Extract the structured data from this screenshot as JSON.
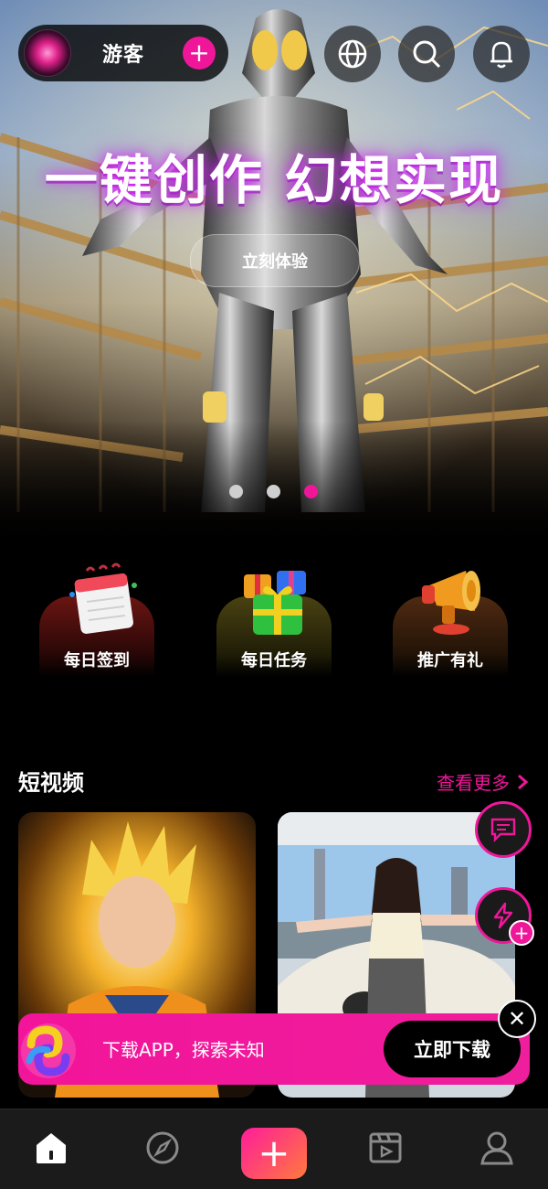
{
  "header": {
    "user_name": "游客",
    "add_label": "+",
    "icons": [
      "globe-icon",
      "search-icon",
      "bell-icon"
    ]
  },
  "hero": {
    "title": "一键创作 幻想实现",
    "cta_label": "立刻体验",
    "carousel": {
      "count": 3,
      "active_index": 2
    }
  },
  "shortcuts": [
    {
      "label": "每日签到",
      "icon": "calendar-icon"
    },
    {
      "label": "每日任务",
      "icon": "gift-icon"
    },
    {
      "label": "推广有礼",
      "icon": "megaphone-icon"
    }
  ],
  "section": {
    "title": "短视频",
    "more_label": "查看更多"
  },
  "floating": {
    "plus_label": "+"
  },
  "banner": {
    "text": "下载APP，探索未知",
    "button_label": "立即下载",
    "close_label": "✕"
  },
  "nav": {
    "items": [
      "home-icon",
      "discover-icon",
      "create-icon",
      "video-icon",
      "profile-icon"
    ],
    "create_label": "+"
  },
  "colors": {
    "accent": "#f0169a",
    "background": "#000000",
    "nav_bg": "#1b1b1b"
  }
}
